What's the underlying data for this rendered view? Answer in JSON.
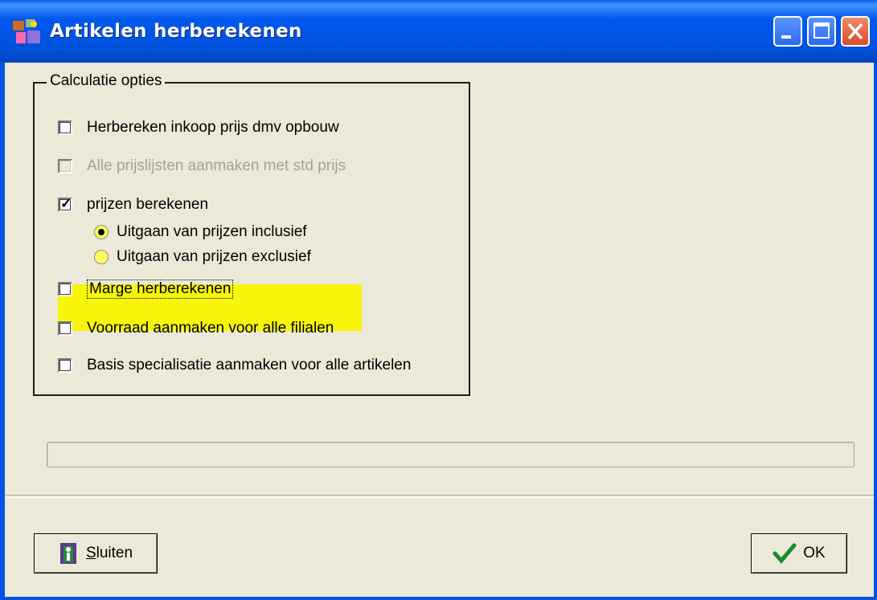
{
  "window": {
    "title": "Artikelen herberekenen"
  },
  "group": {
    "title": "Calculatie opties",
    "options": [
      {
        "label": "Herbereken inkoop prijs dmv opbouw",
        "checked": false,
        "enabled": true
      },
      {
        "label": "Alle prijslijsten aanmaken met std prijs",
        "checked": false,
        "enabled": false
      },
      {
        "label": "prijzen berekenen",
        "checked": true,
        "enabled": true
      },
      {
        "label": "Marge herberekenen",
        "checked": false,
        "enabled": true
      },
      {
        "label": "Voorraad aanmaken voor alle filialen",
        "checked": false,
        "enabled": true
      },
      {
        "label": "Basis specialisatie aanmaken voor alle artikelen",
        "checked": false,
        "enabled": true
      }
    ],
    "radios": [
      {
        "label": "Uitgaan van prijzen inclusief",
        "selected": true
      },
      {
        "label": "Uitgaan van prijzen exclusief",
        "selected": false
      }
    ]
  },
  "progress": {
    "value": 0
  },
  "buttons": {
    "close_label_first": "S",
    "close_label_rest": "luiten",
    "ok_label": "OK"
  },
  "colors": {
    "highlight": "#f6f50a",
    "titlebar": "#0054e3",
    "check_icon": "#1a8a2a"
  }
}
